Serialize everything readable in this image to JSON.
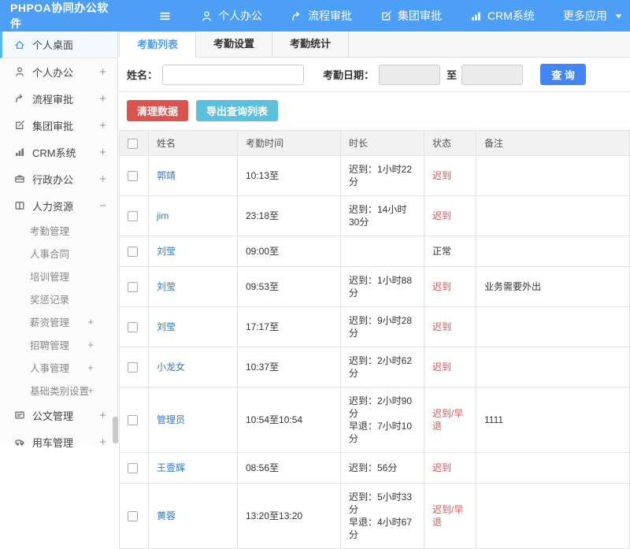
{
  "colors": {
    "topbar": "#4d9ef5",
    "accent": "#4d9ef5",
    "primary": "#4285f4",
    "danger": "#d9534f",
    "info": "#5bc0de",
    "link": "#337ab7"
  },
  "topbar": {
    "logo": "PHPOA协同办公软件",
    "menu_icon": "hamburger-menu-icon",
    "items": [
      {
        "label": "个人办公",
        "icon": "user-icon"
      },
      {
        "label": "流程审批",
        "icon": "flow-icon"
      },
      {
        "label": "集团审批",
        "icon": "edit-icon"
      },
      {
        "label": "CRM系统",
        "icon": "chart-icon"
      },
      {
        "label": "更多应用",
        "icon": "caret-down-icon",
        "icon_after": true
      }
    ]
  },
  "sidebar": {
    "items": [
      {
        "label": "个人桌面",
        "icon": "home-icon",
        "active": true,
        "expand": ""
      },
      {
        "label": "个人办公",
        "icon": "user-icon",
        "expand": "+"
      },
      {
        "label": "流程审批",
        "icon": "flow-icon",
        "expand": "+"
      },
      {
        "label": "集团审批",
        "icon": "edit-icon",
        "expand": "+"
      },
      {
        "label": "CRM系统",
        "icon": "chart-icon",
        "expand": "+"
      },
      {
        "label": "行政办公",
        "icon": "briefcase-icon",
        "expand": "+"
      },
      {
        "label": "人力资源",
        "icon": "book-icon",
        "expand": "−",
        "children": [
          {
            "label": "考勤管理",
            "expand": ""
          },
          {
            "label": "人事合同",
            "expand": ""
          },
          {
            "label": "培训管理",
            "expand": ""
          },
          {
            "label": "奖惩记录",
            "expand": ""
          },
          {
            "label": "薪资管理",
            "expand": "+"
          },
          {
            "label": "招聘管理",
            "expand": "+"
          },
          {
            "label": "人事管理",
            "expand": "+"
          },
          {
            "label": "基础类别设置",
            "expand": "+"
          }
        ]
      },
      {
        "label": "公文管理",
        "icon": "doc-icon",
        "expand": "+"
      },
      {
        "label": "用车管理",
        "icon": "car-icon",
        "expand": "+"
      }
    ]
  },
  "tabs": [
    {
      "label": "考勤列表",
      "active": true
    },
    {
      "label": "考勤设置",
      "active": false
    },
    {
      "label": "考勤统计",
      "active": false
    }
  ],
  "search": {
    "name_label": "姓名：",
    "name_value": "",
    "date_label": "考勤日期：",
    "date_start_value": "",
    "to_label": "至",
    "date_end_value": "",
    "query_label": "查 询"
  },
  "actions": {
    "clean": "清理数据",
    "export": "导出查询列表"
  },
  "table": {
    "headers": [
      "姓名",
      "考勤时间",
      "时长",
      "状态",
      "备注"
    ],
    "rows": [
      {
        "name": "郭靖",
        "time": "10:13至",
        "duration": [
          "迟到：1小时22分"
        ],
        "status": "迟到",
        "status_type": "late",
        "note": ""
      },
      {
        "name": "jim",
        "time": "23:18至",
        "duration": [
          "迟到：14小时30分"
        ],
        "status": "迟到",
        "status_type": "late",
        "note": ""
      },
      {
        "name": "刘莹",
        "time": "09:00至",
        "duration": [],
        "status": "正常",
        "status_type": "normal",
        "note": ""
      },
      {
        "name": "刘莹",
        "time": "09:53至",
        "duration": [
          "迟到：1小时88分"
        ],
        "status": "迟到",
        "status_type": "late",
        "note": "业务需要外出"
      },
      {
        "name": "刘莹",
        "time": "17:17至",
        "duration": [
          "迟到：9小时28分"
        ],
        "status": "迟到",
        "status_type": "late",
        "note": ""
      },
      {
        "name": "小龙女",
        "time": "10:37至",
        "duration": [
          "迟到：2小时62分"
        ],
        "status": "迟到",
        "status_type": "late",
        "note": ""
      },
      {
        "name": "管理员",
        "time": "10:54至10:54",
        "duration": [
          "迟到：2小时90分",
          "早退：7小时10分"
        ],
        "status": "迟到/早退",
        "status_type": "late",
        "note": "1111"
      },
      {
        "name": "王壹辉",
        "time": "08:56至",
        "duration": [
          "迟到：56分"
        ],
        "status": "迟到",
        "status_type": "late",
        "note": ""
      },
      {
        "name": "黄蓉",
        "time": "13:20至13:20",
        "duration": [
          "迟到：5小时33分",
          "早退：4小时67分"
        ],
        "status": "迟到/早退",
        "status_type": "late",
        "note": ""
      }
    ]
  }
}
